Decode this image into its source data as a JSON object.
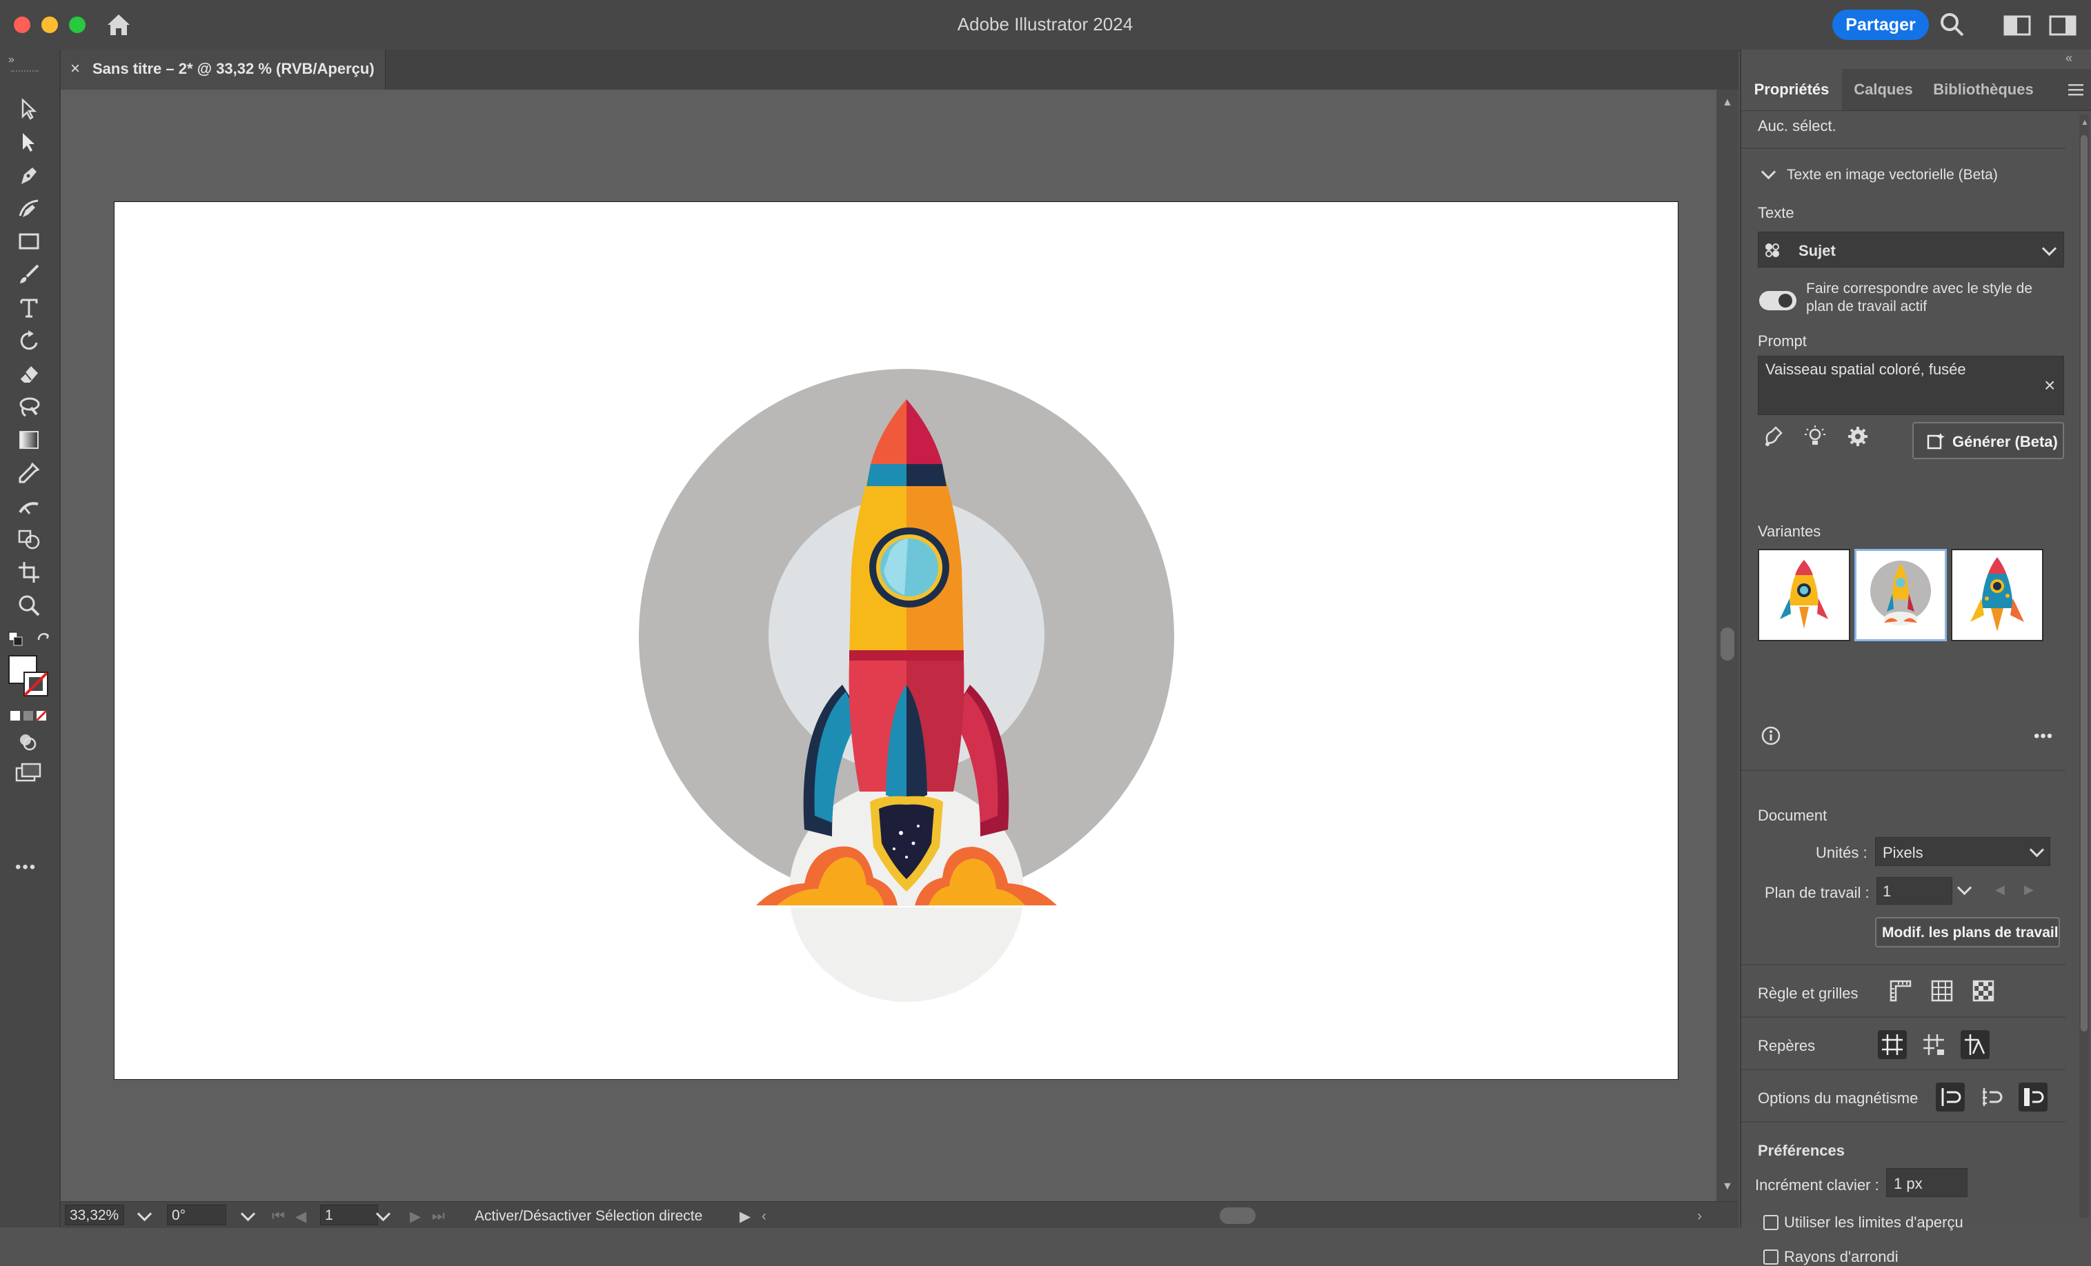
{
  "window": {
    "title": "Adobe Illustrator 2024",
    "share_label": "Partager"
  },
  "document_tab": {
    "title": "Sans titre – 2* @ 33,32 % (RVB/Aperçu)",
    "close_glyph": "×"
  },
  "toolbar": {
    "tools": [
      "selection-tool",
      "direct-selection-tool",
      "pen-tool",
      "curvature-tool",
      "rectangle-tool",
      "paintbrush-tool",
      "type-tool",
      "rotate-tool",
      "eraser-tool",
      "lasso-tool",
      "gradient-tool",
      "eyedropper-tool",
      "width-tool",
      "shape-builder-tool",
      "artboard-tool",
      "zoom-tool"
    ],
    "more_glyph": "•••"
  },
  "panel": {
    "tabs": [
      "Propriétés",
      "Calques",
      "Bibliothèques"
    ],
    "active_tab": "Propriétés",
    "selection_status": "Auc. sélect.",
    "section_title": "Texte en image vectorielle (Beta)",
    "type_label": "Texte",
    "type_value": "Sujet",
    "toggle_label": "Faire correspondre avec le style de plan de travail actif",
    "toggle_on": true,
    "prompt_label": "Prompt",
    "prompt_value": "Vaisseau spatial coloré, fusée",
    "generate_label": "Générer (Beta)",
    "variants_label": "Variantes",
    "variants_selected": 2,
    "document_section": "Document",
    "units_label": "Unités :",
    "units_value": "Pixels",
    "artboard_label": "Plan de travail :",
    "artboard_value": "1",
    "edit_artboards_label": "Modif. les plans de travail",
    "rulers_label": "Règle et grilles",
    "guides_label": "Repères",
    "snap_label": "Options du magnétisme",
    "preferences_label": "Préférences",
    "keyboard_increment_label": "Incrément clavier :",
    "keyboard_increment_value": "1 px",
    "preview_bounds_label": "Utiliser les limites d'aperçu",
    "rounded_corners_label": "Rayons d'arrondi"
  },
  "statusbar": {
    "zoom": "33,32%",
    "rotation": "0°",
    "artboard": "1",
    "status_text": "Activer/Désactiver Sélection directe"
  },
  "colors": {
    "accent": "#1473e6",
    "rocket_yellow": "#f7b81a",
    "rocket_orange": "#f29320",
    "rocket_red": "#e23d4e",
    "window_teal": "#6dc6d8",
    "backdrop_gray": "#b9b8b6"
  }
}
